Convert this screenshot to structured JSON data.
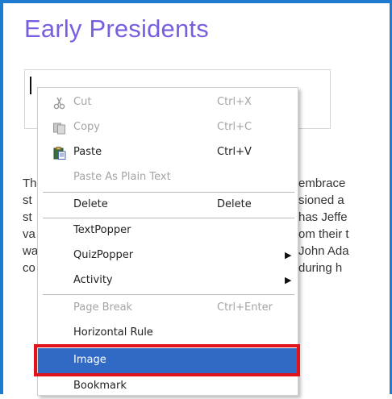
{
  "page": {
    "title": "Early Presidents",
    "accent_color": "#1f7bd0",
    "title_color": "#7a5ee0"
  },
  "body_text": {
    "left_fragments": [
      "Th",
      "st",
      "st",
      "va",
      "wa",
      "co"
    ],
    "right_fragments": [
      "embrace",
      "sioned a",
      "has Jeffe",
      "om their t",
      "John Ada",
      "during h"
    ]
  },
  "context_menu": {
    "items": {
      "cut": {
        "label": "Cut",
        "shortcut": "Ctrl+X",
        "icon": "scissors-icon",
        "enabled": false
      },
      "copy": {
        "label": "Copy",
        "shortcut": "Ctrl+C",
        "icon": "copy-icon",
        "enabled": false
      },
      "paste": {
        "label": "Paste",
        "shortcut": "Ctrl+V",
        "icon": "paste-icon",
        "enabled": true
      },
      "paste_plain": {
        "label": "Paste As Plain Text",
        "enabled": false
      },
      "delete": {
        "label": "Delete",
        "shortcut": "Delete",
        "enabled": true
      },
      "textpopper": {
        "label": "TextPopper",
        "enabled": true
      },
      "quizpopper": {
        "label": "QuizPopper",
        "enabled": true,
        "submenu": true
      },
      "activity": {
        "label": "Activity",
        "enabled": true,
        "submenu": true
      },
      "page_break": {
        "label": "Page Break",
        "shortcut": "Ctrl+Enter",
        "enabled": false
      },
      "horizontal_rule": {
        "label": "Horizontal Rule",
        "enabled": true
      },
      "image": {
        "label": "Image",
        "enabled": true,
        "highlighted": true
      },
      "bookmark": {
        "label": "Bookmark",
        "enabled": true
      }
    },
    "highlight_color": "#316ac5",
    "callout_color": "#e0121b"
  }
}
